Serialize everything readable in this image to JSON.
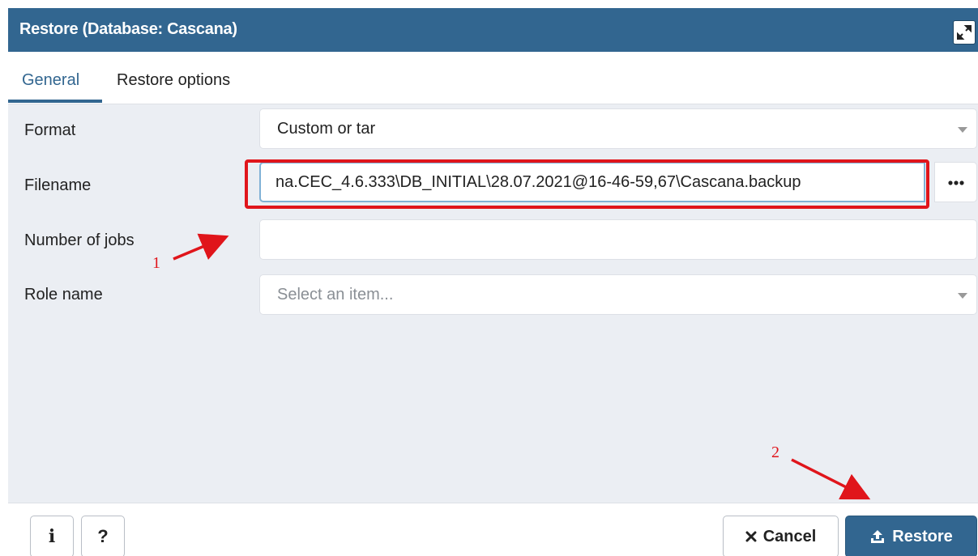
{
  "dialog": {
    "title": "Restore (Database: Cascana)",
    "icons": {
      "maximize": "expand-icon"
    }
  },
  "tabs": [
    {
      "label": "General",
      "active": true
    },
    {
      "label": "Restore options",
      "active": false
    }
  ],
  "form": {
    "format": {
      "label": "Format",
      "value": "Custom or tar"
    },
    "filename": {
      "label": "Filename",
      "value": "na.CEC_4.6.333\\DB_INITIAL\\28.07.2021@16-46-59,67\\Cascana.backup",
      "browse_icon": "ellipsis-icon"
    },
    "jobs": {
      "label": "Number of jobs",
      "value": ""
    },
    "role": {
      "label": "Role name",
      "placeholder": "Select an item..."
    }
  },
  "annotations": {
    "step1": "1",
    "step2": "2"
  },
  "footer": {
    "info_label": "i",
    "help_label": "?",
    "cancel_label": "Cancel",
    "restore_label": "Restore",
    "icons": {
      "cancel": "close-icon",
      "restore": "upload-icon"
    }
  },
  "colors": {
    "primary": "#326690",
    "annotation": "#e0151b",
    "panel_bg": "#ebeef3"
  }
}
